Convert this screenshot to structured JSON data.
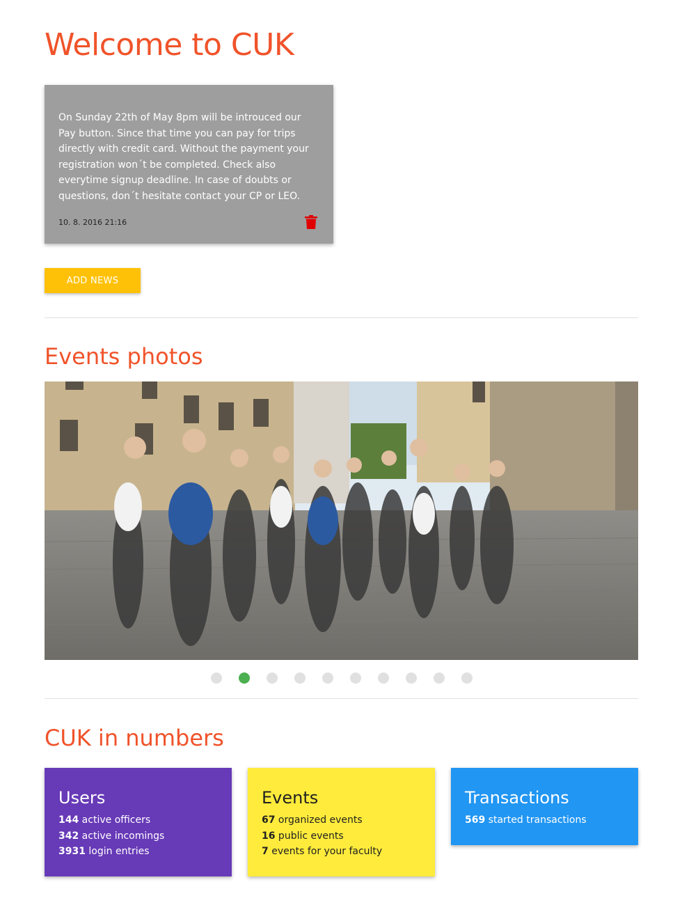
{
  "header": {
    "title": "Welcome to CUK"
  },
  "news": {
    "text": "On Sunday 22th of May 8pm will be introuced our Pay button. Since that time you can pay for trips directly with credit card. Without the payment your registration won´t be completed. Check also everytime signup deadline. In case of doubts or questions, don´t hesitate contact your CP or LEO.",
    "date": "10. 8. 2016 21:16",
    "delete_icon": "trash-icon",
    "add_label": "ADD NEWS"
  },
  "photos": {
    "title": "Events photos",
    "slide_count": 10,
    "active_index": 1
  },
  "numbers": {
    "title": "CUK in numbers",
    "cards": [
      {
        "title": "Users",
        "color": "#673ab7",
        "text_color": "#ffffff",
        "lines": [
          {
            "value": "144",
            "label": "active officers"
          },
          {
            "value": "342",
            "label": "active incomings"
          },
          {
            "value": "3931",
            "label": "login entries"
          }
        ]
      },
      {
        "title": "Events",
        "color": "#ffeb3b",
        "text_color": "#212121",
        "lines": [
          {
            "value": "67",
            "label": "organized events"
          },
          {
            "value": "16",
            "label": "public events"
          },
          {
            "value": "7",
            "label": "events for your faculty"
          }
        ]
      },
      {
        "title": "Transactions",
        "color": "#2196f3",
        "text_color": "#ffffff",
        "lines": [
          {
            "value": "569",
            "label": "started transactions"
          }
        ]
      }
    ]
  },
  "colors": {
    "accent": "#f0532a",
    "news_card": "#9e9e9e",
    "add_button": "#ffc107",
    "dot_active": "#4caf50",
    "dot_inactive": "#e0e0e0",
    "trash": "#e00000"
  }
}
